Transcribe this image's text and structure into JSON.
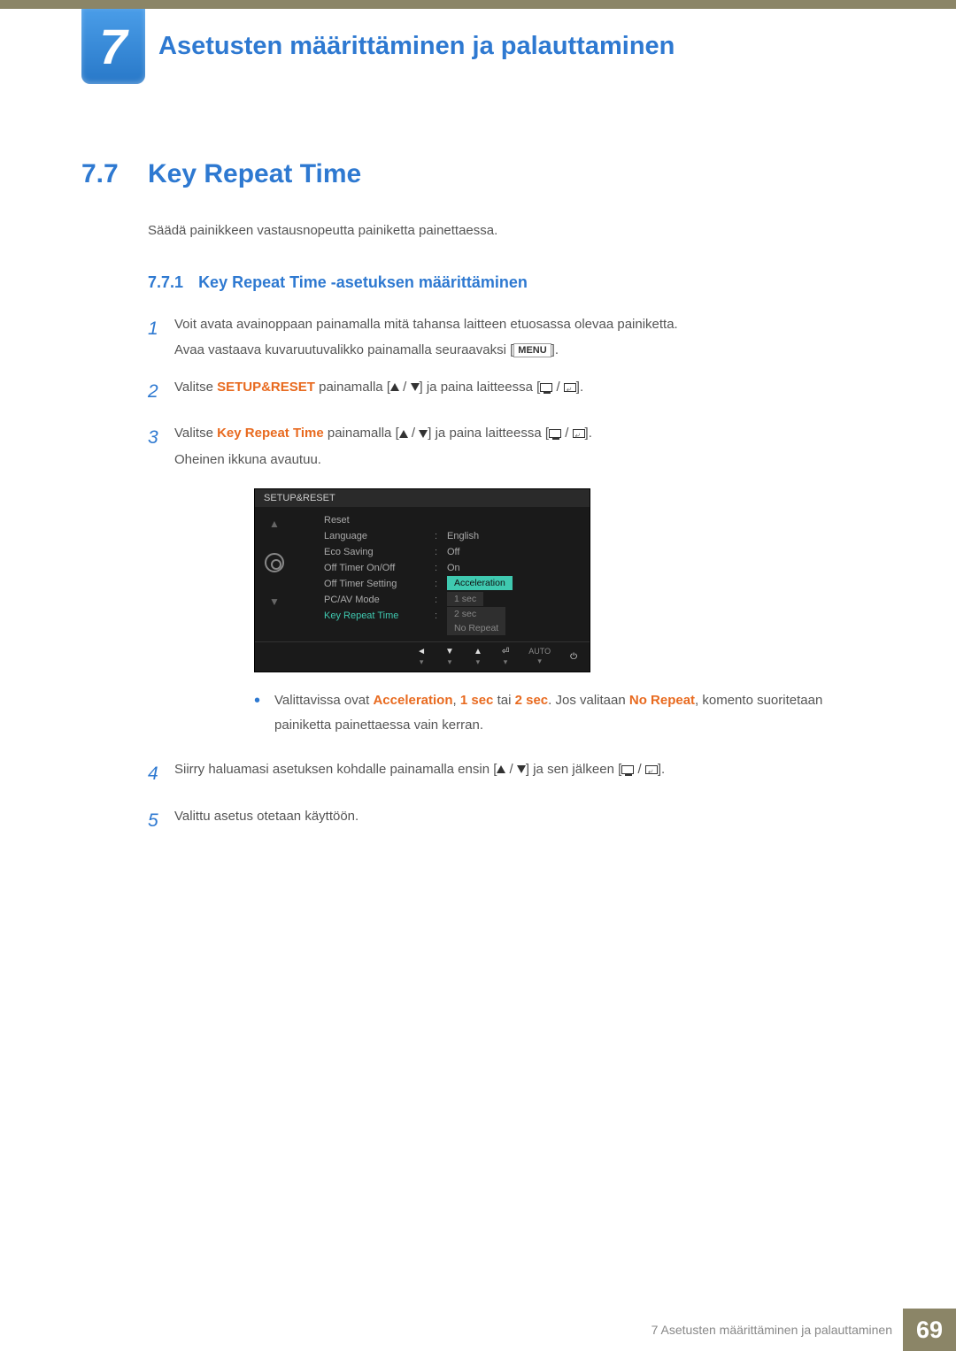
{
  "chapter": {
    "number": "7",
    "title": "Asetusten määrittäminen ja palauttaminen"
  },
  "section": {
    "number": "7.7",
    "title": "Key Repeat Time"
  },
  "intro": "Säädä painikkeen vastausnopeutta painiketta painettaessa.",
  "subsection": {
    "number": "7.7.1",
    "title": "Key Repeat Time -asetuksen määrittäminen"
  },
  "steps": {
    "s1": {
      "num": "1",
      "a": "Voit avata avainoppaan painamalla mitä tahansa laitteen etuosassa olevaa painiketta.",
      "b": "Avaa vastaava kuvaruutuvalikko painamalla seuraavaksi [",
      "menu": "MENU",
      "c": "]."
    },
    "s2": {
      "num": "2",
      "a": "Valitse ",
      "setup": "SETUP&RESET",
      "b": " painamalla [",
      "c": "] ja paina laitteessa [",
      "d": "]."
    },
    "s3": {
      "num": "3",
      "a": "Valitse ",
      "krt": "Key Repeat Time",
      "b": " painamalla [",
      "c": "] ja paina laitteessa [",
      "d": "].",
      "e": "Oheinen ikkuna avautuu."
    },
    "s4": {
      "num": "4",
      "a": "Siirry haluamasi asetuksen kohdalle painamalla ensin [",
      "b": "] ja sen jälkeen [",
      "c": "]."
    },
    "s5": {
      "num": "5",
      "a": "Valittu asetus otetaan käyttöön."
    }
  },
  "bullet": {
    "a": "Valittavissa ovat ",
    "acc": "Acceleration",
    "sep1": ", ",
    "one": "1 sec",
    "sep2": " tai ",
    "two": "2 sec",
    "b": ". Jos valitaan ",
    "nr": "No Repeat",
    "c": ", komento suoritetaan painiketta painettaessa vain kerran."
  },
  "osd": {
    "title": "SETUP&RESET",
    "rows": {
      "reset": {
        "label": "Reset",
        "val": ""
      },
      "lang": {
        "label": "Language",
        "val": "English"
      },
      "eco": {
        "label": "Eco Saving",
        "val": "Off"
      },
      "timerOn": {
        "label": "Off Timer On/Off",
        "val": "On"
      },
      "timerSet": {
        "label": "Off Timer Setting",
        "val": ""
      },
      "pcav": {
        "label": "PC/AV Mode",
        "val": ""
      },
      "krt": {
        "label": "Key Repeat Time",
        "val": ""
      }
    },
    "options": {
      "acc": "Acceleration",
      "one": "1 sec",
      "two": "2 sec",
      "nr": "No Repeat"
    },
    "footer_auto": "AUTO"
  },
  "footer": {
    "text": "7 Asetusten määrittäminen ja palauttaminen",
    "page": "69"
  }
}
